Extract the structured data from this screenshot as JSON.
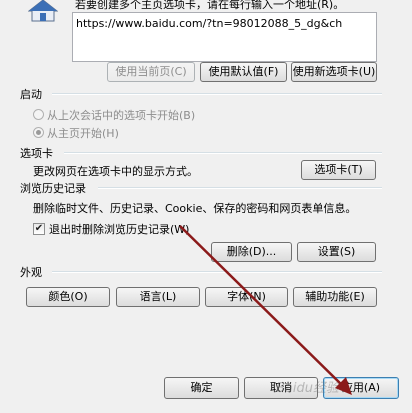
{
  "homepage": {
    "hint": "若要创建多个主页选项卡，请在每行输入一个地址(R)。",
    "url": "https://www.baidu.com/?tn=98012088_5_dg&ch",
    "btn_current": "使用当前页(C)",
    "btn_default": "使用默认值(F)",
    "btn_newtab": "使用新选项卡(U)"
  },
  "startup": {
    "title": "启动",
    "option_last": "从上次会话中的选项卡开始(B)",
    "option_home": "从主页开始(H)"
  },
  "tabs": {
    "title": "选项卡",
    "desc": "更改网页在选项卡中的显示方式。",
    "button": "选项卡(T)"
  },
  "history": {
    "title": "浏览历史记录",
    "desc": "删除临时文件、历史记录、Cookie、保存的密码和网页表单信息。",
    "checkbox_label": "退出时删除浏览历史记录(W)",
    "checkbox_checked": true,
    "btn_delete": "删除(D)...",
    "btn_settings": "设置(S)"
  },
  "appearance": {
    "title": "外观",
    "btn_colors": "颜色(O)",
    "btn_languages": "语言(L)",
    "btn_fonts": "字体(N)",
    "btn_accessibility": "辅助功能(E)"
  },
  "footer": {
    "ok": "确定",
    "cancel": "取消",
    "apply": "应用(A)"
  },
  "watermark": "Baidu经验",
  "colors": {
    "arrow": "#8b1a1a"
  }
}
